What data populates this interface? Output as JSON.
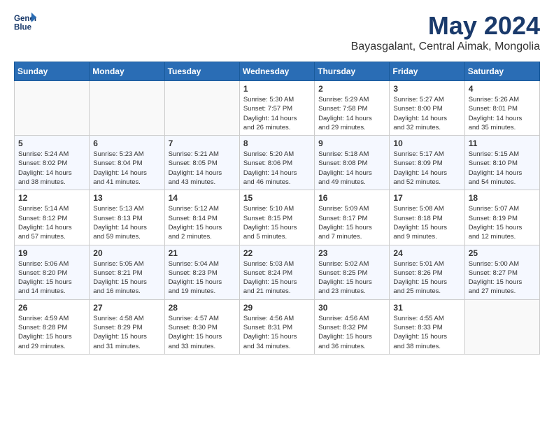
{
  "header": {
    "logo_line1": "General",
    "logo_line2": "Blue",
    "month_title": "May 2024",
    "location": "Bayasgalant, Central Aimak, Mongolia"
  },
  "weekdays": [
    "Sunday",
    "Monday",
    "Tuesday",
    "Wednesday",
    "Thursday",
    "Friday",
    "Saturday"
  ],
  "weeks": [
    [
      {
        "day": "",
        "info": ""
      },
      {
        "day": "",
        "info": ""
      },
      {
        "day": "",
        "info": ""
      },
      {
        "day": "1",
        "info": "Sunrise: 5:30 AM\nSunset: 7:57 PM\nDaylight: 14 hours\nand 26 minutes."
      },
      {
        "day": "2",
        "info": "Sunrise: 5:29 AM\nSunset: 7:58 PM\nDaylight: 14 hours\nand 29 minutes."
      },
      {
        "day": "3",
        "info": "Sunrise: 5:27 AM\nSunset: 8:00 PM\nDaylight: 14 hours\nand 32 minutes."
      },
      {
        "day": "4",
        "info": "Sunrise: 5:26 AM\nSunset: 8:01 PM\nDaylight: 14 hours\nand 35 minutes."
      }
    ],
    [
      {
        "day": "5",
        "info": "Sunrise: 5:24 AM\nSunset: 8:02 PM\nDaylight: 14 hours\nand 38 minutes."
      },
      {
        "day": "6",
        "info": "Sunrise: 5:23 AM\nSunset: 8:04 PM\nDaylight: 14 hours\nand 41 minutes."
      },
      {
        "day": "7",
        "info": "Sunrise: 5:21 AM\nSunset: 8:05 PM\nDaylight: 14 hours\nand 43 minutes."
      },
      {
        "day": "8",
        "info": "Sunrise: 5:20 AM\nSunset: 8:06 PM\nDaylight: 14 hours\nand 46 minutes."
      },
      {
        "day": "9",
        "info": "Sunrise: 5:18 AM\nSunset: 8:08 PM\nDaylight: 14 hours\nand 49 minutes."
      },
      {
        "day": "10",
        "info": "Sunrise: 5:17 AM\nSunset: 8:09 PM\nDaylight: 14 hours\nand 52 minutes."
      },
      {
        "day": "11",
        "info": "Sunrise: 5:15 AM\nSunset: 8:10 PM\nDaylight: 14 hours\nand 54 minutes."
      }
    ],
    [
      {
        "day": "12",
        "info": "Sunrise: 5:14 AM\nSunset: 8:12 PM\nDaylight: 14 hours\nand 57 minutes."
      },
      {
        "day": "13",
        "info": "Sunrise: 5:13 AM\nSunset: 8:13 PM\nDaylight: 14 hours\nand 59 minutes."
      },
      {
        "day": "14",
        "info": "Sunrise: 5:12 AM\nSunset: 8:14 PM\nDaylight: 15 hours\nand 2 minutes."
      },
      {
        "day": "15",
        "info": "Sunrise: 5:10 AM\nSunset: 8:15 PM\nDaylight: 15 hours\nand 5 minutes."
      },
      {
        "day": "16",
        "info": "Sunrise: 5:09 AM\nSunset: 8:17 PM\nDaylight: 15 hours\nand 7 minutes."
      },
      {
        "day": "17",
        "info": "Sunrise: 5:08 AM\nSunset: 8:18 PM\nDaylight: 15 hours\nand 9 minutes."
      },
      {
        "day": "18",
        "info": "Sunrise: 5:07 AM\nSunset: 8:19 PM\nDaylight: 15 hours\nand 12 minutes."
      }
    ],
    [
      {
        "day": "19",
        "info": "Sunrise: 5:06 AM\nSunset: 8:20 PM\nDaylight: 15 hours\nand 14 minutes."
      },
      {
        "day": "20",
        "info": "Sunrise: 5:05 AM\nSunset: 8:21 PM\nDaylight: 15 hours\nand 16 minutes."
      },
      {
        "day": "21",
        "info": "Sunrise: 5:04 AM\nSunset: 8:23 PM\nDaylight: 15 hours\nand 19 minutes."
      },
      {
        "day": "22",
        "info": "Sunrise: 5:03 AM\nSunset: 8:24 PM\nDaylight: 15 hours\nand 21 minutes."
      },
      {
        "day": "23",
        "info": "Sunrise: 5:02 AM\nSunset: 8:25 PM\nDaylight: 15 hours\nand 23 minutes."
      },
      {
        "day": "24",
        "info": "Sunrise: 5:01 AM\nSunset: 8:26 PM\nDaylight: 15 hours\nand 25 minutes."
      },
      {
        "day": "25",
        "info": "Sunrise: 5:00 AM\nSunset: 8:27 PM\nDaylight: 15 hours\nand 27 minutes."
      }
    ],
    [
      {
        "day": "26",
        "info": "Sunrise: 4:59 AM\nSunset: 8:28 PM\nDaylight: 15 hours\nand 29 minutes."
      },
      {
        "day": "27",
        "info": "Sunrise: 4:58 AM\nSunset: 8:29 PM\nDaylight: 15 hours\nand 31 minutes."
      },
      {
        "day": "28",
        "info": "Sunrise: 4:57 AM\nSunset: 8:30 PM\nDaylight: 15 hours\nand 33 minutes."
      },
      {
        "day": "29",
        "info": "Sunrise: 4:56 AM\nSunset: 8:31 PM\nDaylight: 15 hours\nand 34 minutes."
      },
      {
        "day": "30",
        "info": "Sunrise: 4:56 AM\nSunset: 8:32 PM\nDaylight: 15 hours\nand 36 minutes."
      },
      {
        "day": "31",
        "info": "Sunrise: 4:55 AM\nSunset: 8:33 PM\nDaylight: 15 hours\nand 38 minutes."
      },
      {
        "day": "",
        "info": ""
      }
    ]
  ]
}
